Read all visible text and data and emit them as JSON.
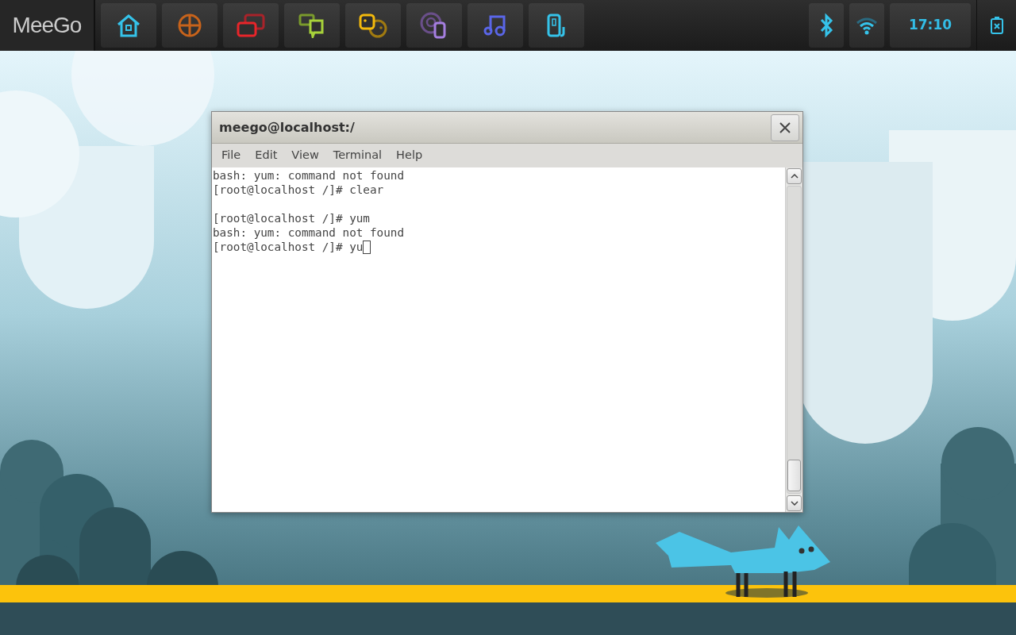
{
  "top_bar": {
    "logo": "MeeGo",
    "clock": "17:10"
  },
  "terminal": {
    "title": "meego@localhost:/",
    "menu": [
      "File",
      "Edit",
      "View",
      "Terminal",
      "Help"
    ],
    "output": "bash: yum: command not found\n[root@localhost /]# clear\n\n[root@localhost /]# yum\nbash: yum: command not found\n[root@localhost /]# yu",
    "cursor": true
  }
}
